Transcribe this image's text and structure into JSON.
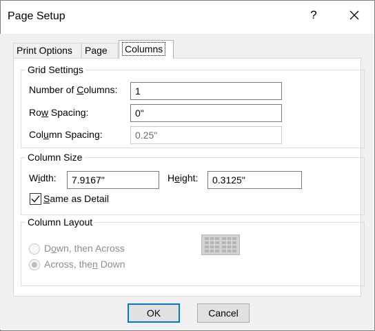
{
  "dialog": {
    "title": "Page Setup",
    "help_label": "?"
  },
  "tabs": [
    {
      "label": "Print Options",
      "active": false
    },
    {
      "label": "Page",
      "active": false
    },
    {
      "label": "Columns",
      "active": true
    }
  ],
  "grid_settings": {
    "legend": "Grid Settings",
    "num_columns": {
      "label_pre": "Number of ",
      "label_u": "C",
      "label_post": "olumns:",
      "value": "1"
    },
    "row_spacing": {
      "label_pre": "Ro",
      "label_u": "w",
      "label_post": " Spacing:",
      "value": "0\""
    },
    "column_spacing": {
      "label_pre": "Col",
      "label_u": "u",
      "label_post": "mn Spacing:",
      "value": "0.25\""
    }
  },
  "column_size": {
    "legend": "Column Size",
    "width": {
      "label_pre": "W",
      "label_u": "i",
      "label_post": "dth:",
      "value": "7.9167\""
    },
    "height": {
      "label_pre": "H",
      "label_u": "e",
      "label_post": "ight:",
      "value": "0.3125\""
    },
    "same_as_detail": {
      "label_u": "S",
      "label_post": "ame as Detail",
      "checked": true
    }
  },
  "column_layout": {
    "legend": "Column Layout",
    "option1": {
      "label_pre": "D",
      "label_u": "o",
      "label_post": "wn, then Across",
      "selected": false
    },
    "option2": {
      "label_pre": "Across, the",
      "label_u": "n",
      "label_post": " Down",
      "selected": true
    }
  },
  "buttons": {
    "ok": "OK",
    "cancel": "Cancel"
  },
  "icons": {
    "close": "close-icon",
    "check": "checkmark-icon",
    "layout_preview": "column-layout-preview-icon"
  }
}
